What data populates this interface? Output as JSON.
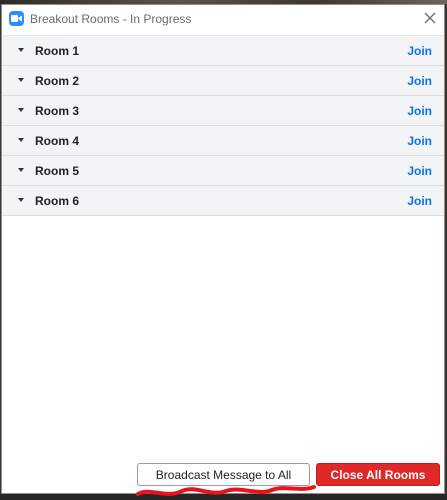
{
  "window": {
    "title": "Breakout Rooms - In Progress",
    "close_icon": "close-icon"
  },
  "rooms": [
    {
      "name": "Room 1",
      "action": "Join"
    },
    {
      "name": "Room 2",
      "action": "Join"
    },
    {
      "name": "Room 3",
      "action": "Join"
    },
    {
      "name": "Room 4",
      "action": "Join"
    },
    {
      "name": "Room 5",
      "action": "Join"
    },
    {
      "name": "Room 6",
      "action": "Join"
    }
  ],
  "footer": {
    "broadcast_label": "Broadcast Message to All",
    "close_all_label": "Close All Rooms"
  },
  "colors": {
    "accent": "#0e71eb",
    "danger": "#e02828",
    "annotation": "#e8141c"
  }
}
